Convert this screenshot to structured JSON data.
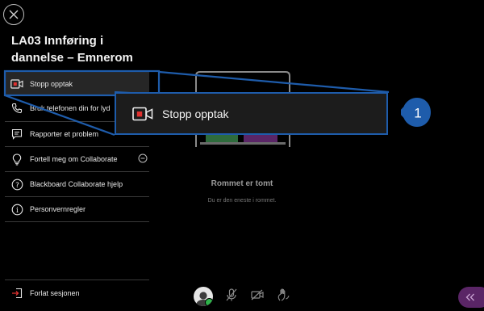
{
  "session": {
    "title_line1": "LA03 Innføring i",
    "title_line2": "dannelse – Emnerom"
  },
  "menu": {
    "items": [
      {
        "label": "Stopp opptak",
        "icon": "record-stop-icon"
      },
      {
        "label": "Bruk telefonen din for lyd",
        "icon": "phone-icon"
      },
      {
        "label": "Rapporter et problem",
        "icon": "report-icon"
      },
      {
        "label": "Fortell meg om Collaborate",
        "icon": "lightbulb-icon"
      },
      {
        "label": "Blackboard Collaborate hjelp",
        "icon": "help-icon"
      },
      {
        "label": "Personvernregler",
        "icon": "info-icon"
      }
    ],
    "leave_label": "Forlat sesjonen"
  },
  "stage": {
    "empty_title": "Rommet er tomt",
    "empty_subtitle": "Du er den eneste i rommet."
  },
  "callout": {
    "label": "Stopp opptak",
    "number": "1"
  },
  "colors": {
    "callout_border": "#1e5cab",
    "badge": "#1e5cab",
    "record_red": "#e0312f",
    "collapse_bg": "#5a2566",
    "online_green": "#2eb24a"
  }
}
